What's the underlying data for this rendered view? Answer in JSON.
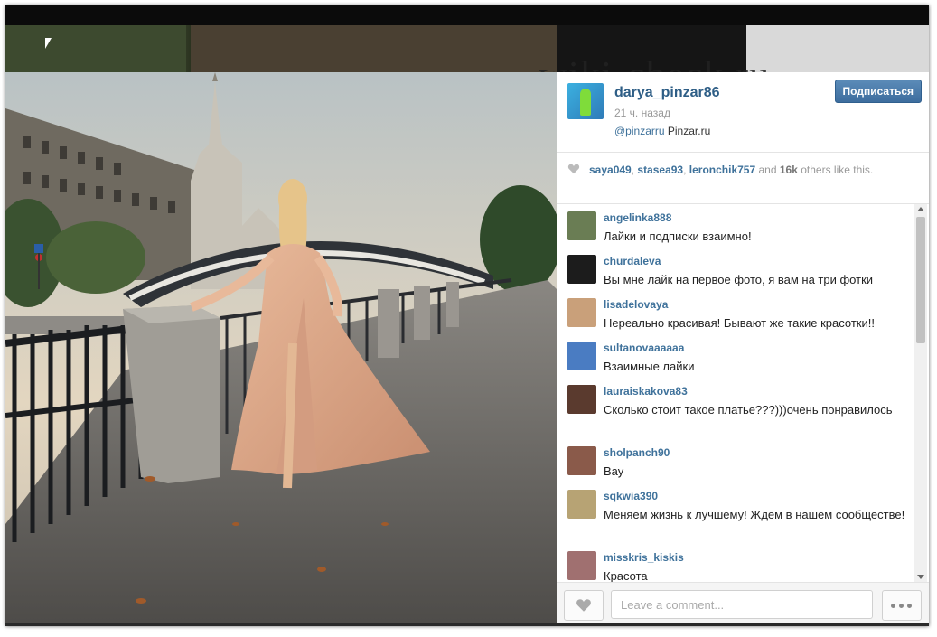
{
  "watermark": "wiki-check.ru",
  "post": {
    "username": "darya_pinzar86",
    "time": "21 ч. назад",
    "caption_mention": "@pinzarru",
    "caption_text": " Pinzar.ru ",
    "follow_label": "Подписаться",
    "avatar_icon": "user-avatar-icon"
  },
  "likes": {
    "users": [
      "saya049",
      "stasea93",
      "leronchik757"
    ],
    "separator": ", ",
    "and": " and ",
    "count": "16k",
    "others": " others like this."
  },
  "comments": [
    {
      "user": "angelinka888",
      "text": "Лайки и подписки взаимно!",
      "avatar_color": "#6a7d54"
    },
    {
      "user": "churdaleva",
      "text": "Вы мне лайк на первое фото, я вам на три фотки",
      "avatar_color": "#1c1c1c"
    },
    {
      "user": "lisadelovaya",
      "text": "Нереально красивая! Бывают же такие красотки!!",
      "avatar_color": "#c9a07a"
    },
    {
      "user": "sultanovaaaaaa",
      "text": "Взаимные лайки",
      "avatar_color": "#4a7cc2"
    },
    {
      "user": "lauraiskakova83",
      "text": "Сколько стоит такое платье???)))очень понравилось",
      "avatar_color": "#5a3a2e"
    },
    {
      "user": "sholpanch90",
      "text": "Вау",
      "avatar_color": "#8a5a4a"
    },
    {
      "user": "sqkwia390",
      "text": "Меняем жизнь к лучшему! Ждем в нашем сообществе!",
      "avatar_color": "#b7a374"
    },
    {
      "user": "misskris_kiskis",
      "text": "Красота",
      "avatar_color": "#a07070"
    }
  ],
  "footer": {
    "comment_placeholder": "Leave a comment..."
  },
  "colors": {
    "link": "#3f729b",
    "follow_button": "#4a7aab"
  }
}
